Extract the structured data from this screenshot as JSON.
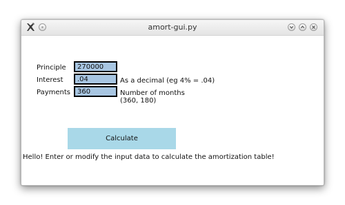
{
  "window": {
    "title": "amort-gui.py"
  },
  "form": {
    "principle": {
      "label": "Principle",
      "value": "270000"
    },
    "interest": {
      "label": "Interest",
      "value": ".04",
      "hint": "As a decimal (eg 4% = .04)"
    },
    "payments": {
      "label": "Payments",
      "value": "360",
      "hint_line1": "Number of months",
      "hint_line2": "(360, 180)"
    }
  },
  "actions": {
    "calculate_label": "Calculate"
  },
  "status": {
    "message": "Hello! Enter or modify the input data to calculate the amortization table!"
  },
  "colors": {
    "field_bg": "#a8c6e2",
    "button_bg": "#a9d8e8"
  }
}
